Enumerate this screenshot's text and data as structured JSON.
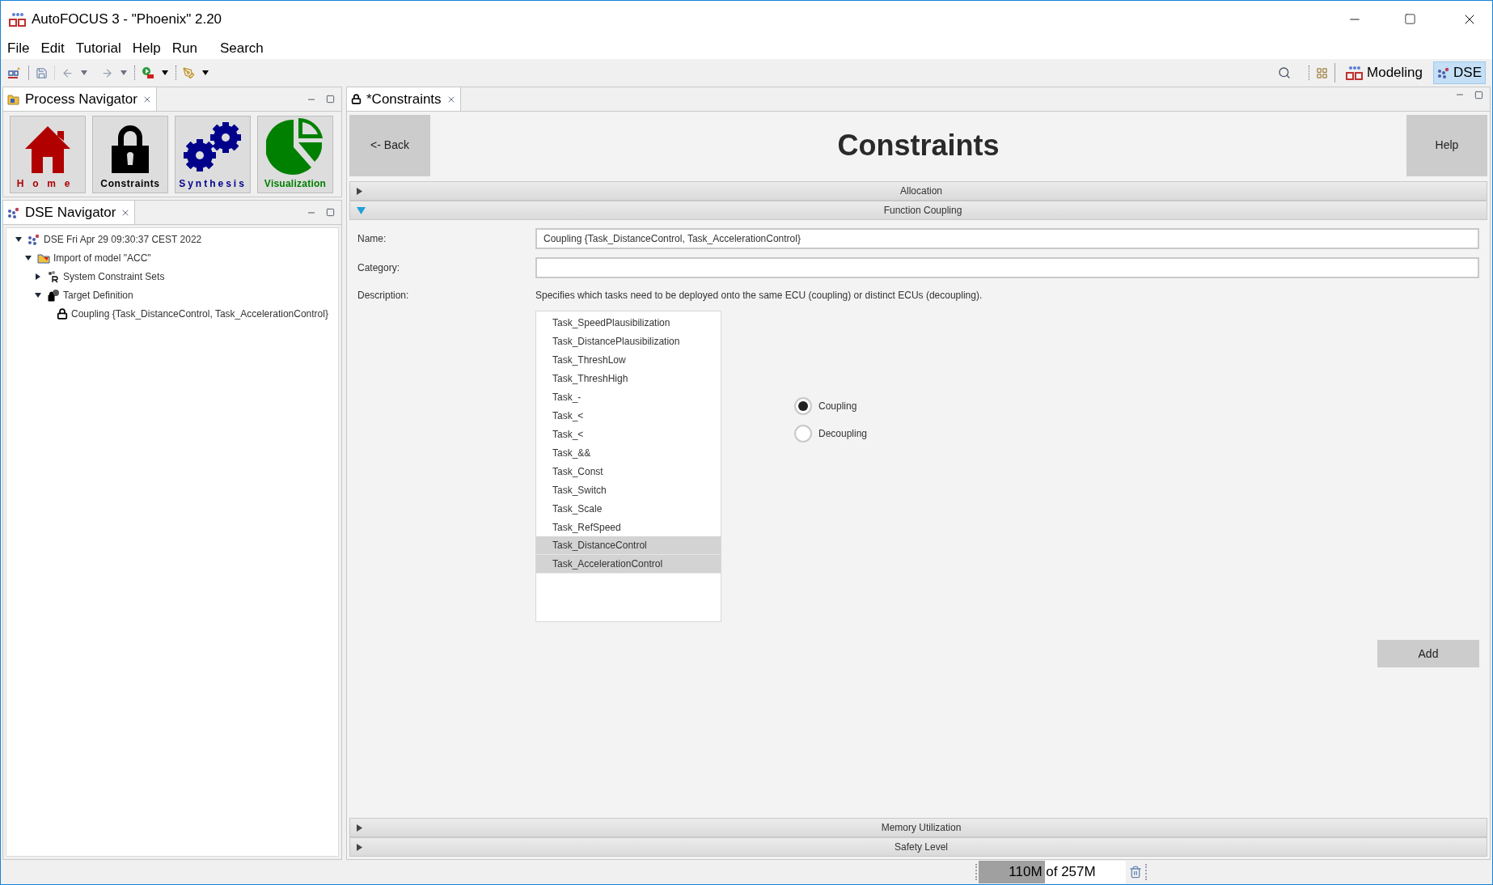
{
  "window": {
    "title": "AutoFOCUS 3 - \"Phoenix\" 2.20"
  },
  "menu": [
    "File",
    "Edit",
    "Tutorial",
    "Help",
    "Run",
    "Search"
  ],
  "perspectives": [
    {
      "label": "Modeling",
      "kind": "modeling",
      "selected": false
    },
    {
      "label": "DSE",
      "kind": "dse",
      "selected": true
    }
  ],
  "process_navigator": {
    "title": "Process Navigator",
    "tiles": [
      {
        "label": "Home",
        "kind": "home"
      },
      {
        "label": "Constraints",
        "kind": "constraints"
      },
      {
        "label": "Synthesis",
        "kind": "synthesis"
      },
      {
        "label": "Visualization",
        "kind": "visualization"
      }
    ]
  },
  "dse_navigator": {
    "title": "DSE Navigator",
    "tree": [
      {
        "label": "DSE Fri Apr 29 09:30:37 CEST 2022",
        "kind": "dse",
        "expanded": true,
        "children": [
          {
            "label": "Import of model \"ACC\"",
            "kind": "import",
            "expanded": true,
            "children": [
              {
                "label": "System Constraint Sets",
                "kind": "constraint_sets",
                "expanded": false
              },
              {
                "label": "Target Definition",
                "kind": "target",
                "expanded": true,
                "children": [
                  {
                    "label": "Coupling {Task_DistanceControl, Task_AccelerationControl}",
                    "kind": "coupling"
                  }
                ]
              }
            ]
          }
        ]
      }
    ]
  },
  "editor": {
    "tab": "*Constraints",
    "back": "<- Back",
    "heading": "Constraints",
    "help": "Help",
    "sections": [
      {
        "title": "Allocation",
        "expanded": false
      },
      {
        "title": "Function Coupling",
        "expanded": true
      },
      {
        "title": "Memory Utilization",
        "expanded": false
      },
      {
        "title": "Safety Level",
        "expanded": false
      }
    ],
    "form": {
      "name_label": "Name:",
      "name_value": "Coupling {Task_DistanceControl, Task_AccelerationControl}",
      "category_label": "Category:",
      "description_label": "Description:",
      "description": "Specifies which tasks need to be deployed onto the same ECU (coupling) or distinct ECUs (decoupling).",
      "tasks": [
        {
          "label": "Task_SpeedPlausibilization",
          "selected": false
        },
        {
          "label": "Task_DistancePlausibilization",
          "selected": false
        },
        {
          "label": "Task_ThreshLow",
          "selected": false
        },
        {
          "label": "Task_ThreshHigh",
          "selected": false
        },
        {
          "label": "Task_-",
          "selected": false
        },
        {
          "label": "Task_<",
          "selected": false
        },
        {
          "label": "Task_<",
          "selected": false
        },
        {
          "label": "Task_&&",
          "selected": false
        },
        {
          "label": "Task_Const",
          "selected": false
        },
        {
          "label": "Task_Switch",
          "selected": false
        },
        {
          "label": "Task_Scale",
          "selected": false
        },
        {
          "label": "Task_RefSpeed",
          "selected": false
        },
        {
          "label": "Task_DistanceControl",
          "selected": true
        },
        {
          "label": "Task_AccelerationControl",
          "selected": true
        }
      ],
      "modes": [
        {
          "label": "Coupling",
          "selected": true
        },
        {
          "label": "Decoupling",
          "selected": false
        }
      ],
      "add": "Add"
    }
  },
  "status_bar": {
    "memory": "110M of 257M",
    "level": 0.45
  }
}
